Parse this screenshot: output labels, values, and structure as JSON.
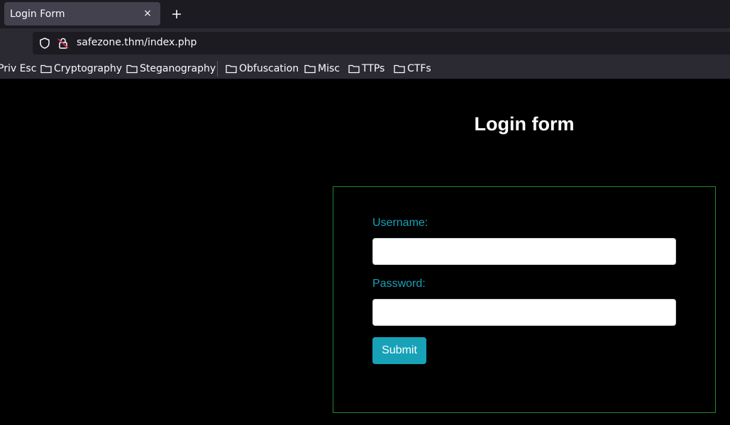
{
  "browser": {
    "tab": {
      "title": "Login Form",
      "close_glyph": "×"
    },
    "new_tab_icon": "plus-icon",
    "url": "safezone.thm/index.php",
    "bookmarks": [
      {
        "label": "Priv Esc",
        "icon": "none"
      },
      {
        "label": "Cryptography",
        "icon": "folder-icon"
      },
      {
        "label": "Steganography",
        "icon": "folder-icon"
      },
      {
        "label": "Obfuscation",
        "icon": "folder-icon"
      },
      {
        "label": "Misc",
        "icon": "folder-icon"
      },
      {
        "label": "TTPs",
        "icon": "folder-icon"
      },
      {
        "label": "CTFs",
        "icon": "folder-icon"
      }
    ]
  },
  "page": {
    "title": "Login form",
    "username_label": "Username:",
    "username_value": "",
    "password_label": "Password:",
    "password_value": "",
    "submit_label": "Submit"
  },
  "colors": {
    "background": "#000000",
    "label": "#17a2b8",
    "button": "#17a2b8",
    "form_border": "#1f8a2a"
  }
}
